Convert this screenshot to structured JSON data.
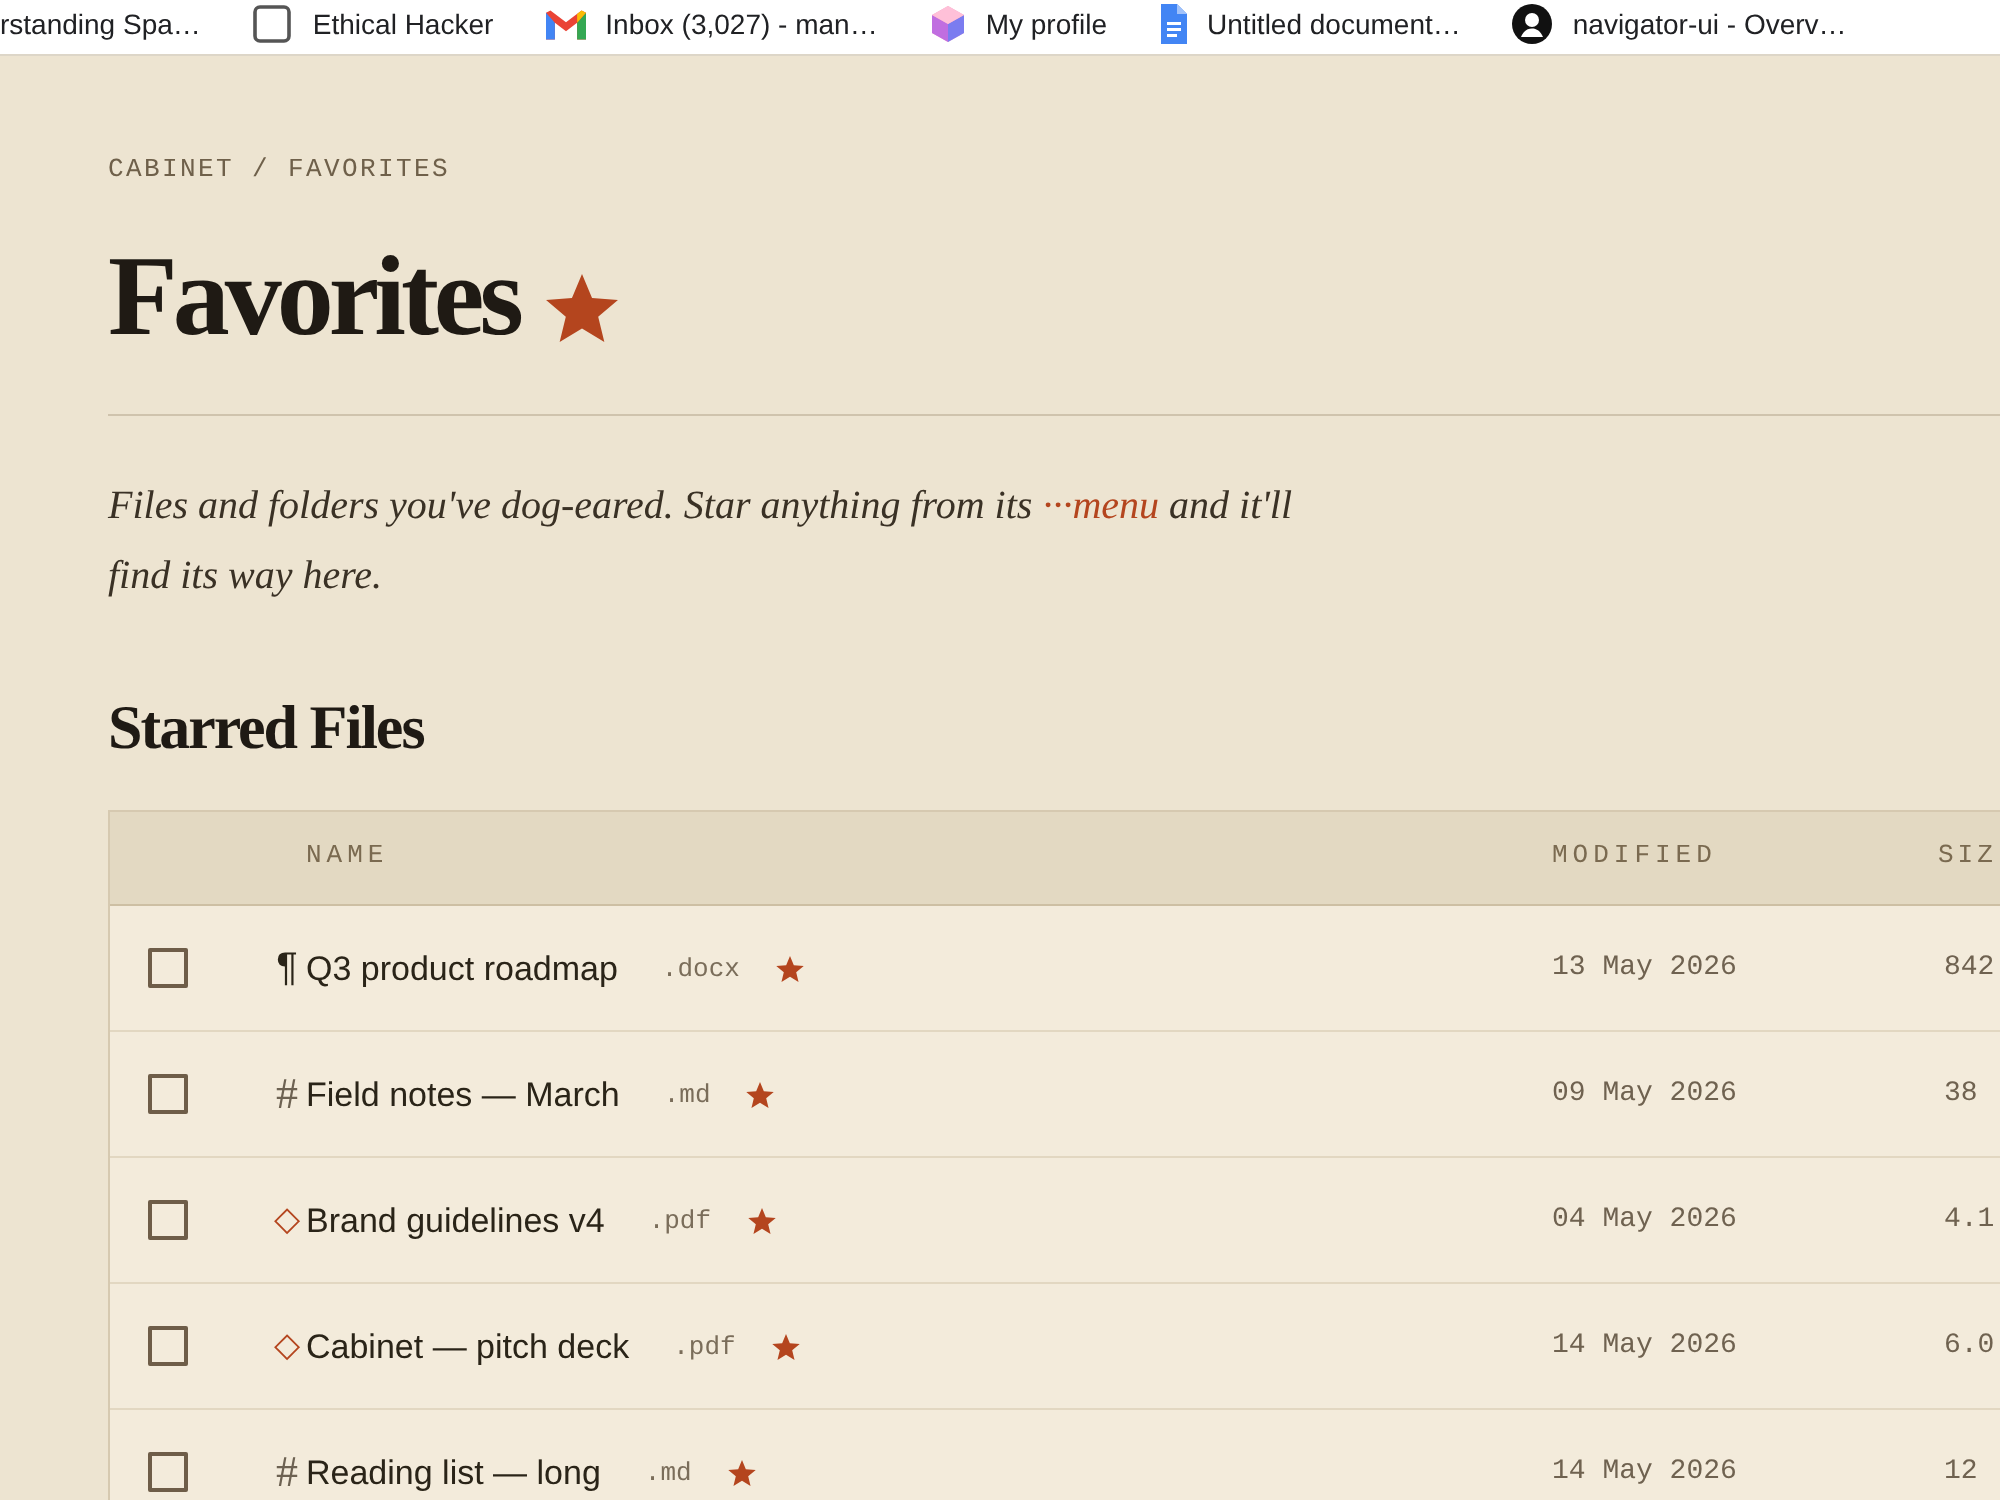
{
  "bookmarks": [
    {
      "kind": "none",
      "label": "rstanding Spa…"
    },
    {
      "kind": "square",
      "label": "Ethical Hacker"
    },
    {
      "kind": "mail",
      "label": "Inbox (3,027) - man…"
    },
    {
      "kind": "cube",
      "label": "My profile"
    },
    {
      "kind": "doc",
      "label": "Untitled document…"
    },
    {
      "kind": "avatar",
      "label": "navigator-ui - Overv…"
    }
  ],
  "breadcrumb": {
    "items": [
      "CABINET",
      "FAVORITES"
    ],
    "separator": "/"
  },
  "title": "Favorites",
  "title_starred": true,
  "description": {
    "before": "Files and folders you've dog-eared. Star anything from its ",
    "link": "···menu",
    "after": " and it'll find its way here."
  },
  "section_title": "Starred Files",
  "table": {
    "columns": [
      "NAME",
      "MODIFIED",
      "SIZ"
    ],
    "rows": [
      {
        "checked": false,
        "kind": "doc",
        "glyph": "¶",
        "name": "Q3 product roadmap",
        "ext": ".docx",
        "starred": true,
        "modified": "13 May 2026",
        "size": "842"
      },
      {
        "checked": false,
        "kind": "md",
        "glyph": "#",
        "name": "Field notes — March",
        "ext": ".md",
        "starred": true,
        "modified": "09 May 2026",
        "size": "38"
      },
      {
        "checked": false,
        "kind": "pdf",
        "glyph": "◇",
        "name": "Brand guidelines v4",
        "ext": ".pdf",
        "starred": true,
        "modified": "04 May 2026",
        "size": "4.1"
      },
      {
        "checked": false,
        "kind": "pdf",
        "glyph": "◇",
        "name": "Cabinet — pitch deck",
        "ext": ".pdf",
        "starred": true,
        "modified": "14 May 2026",
        "size": "6.0"
      },
      {
        "checked": false,
        "kind": "md",
        "glyph": "#",
        "name": "Reading list — long",
        "ext": ".md",
        "starred": true,
        "modified": "14 May 2026",
        "size": "12"
      }
    ]
  }
}
